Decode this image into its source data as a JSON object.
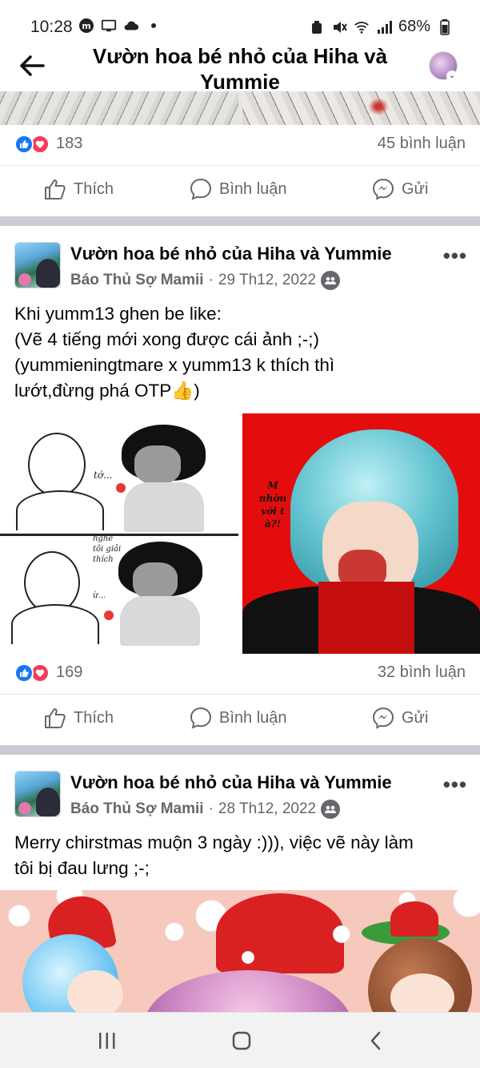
{
  "status_bar": {
    "time": "10:28",
    "battery": "68%"
  },
  "header": {
    "title": "Vườn hoa bé nhỏ của Hiha và Yummie"
  },
  "top_post": {
    "reaction_count": "183",
    "comment_count": "45 bình luận"
  },
  "actions": {
    "like": "Thích",
    "comment": "Bình luận",
    "send": "Gửi"
  },
  "posts": [
    {
      "group": "Vườn hoa bé nhỏ của Hiha và Yummie",
      "author": "Báo Thủ Sợ Mamii",
      "date": "29 Th12, 2022",
      "text_lines": [
        "Khi yumm13 ghen be like:",
        "(Vẽ 4 tiếng mới xong được cái ảnh ;-;)",
        "(yummieningtmare x yumm13 k thích thì",
        "lướt,đừng phá OTP👍)"
      ],
      "image_text": {
        "sketch_1": "tớ...",
        "sketch_2": "nghe tôi giải thích",
        "sketch_3": "ừ...",
        "red_panel": "M nhờn với t à?!"
      },
      "reaction_count": "169",
      "comment_count": "32 bình luận"
    },
    {
      "group": "Vườn hoa bé nhỏ của Hiha và Yummie",
      "author": "Báo Thủ Sợ Mamii",
      "date": "28 Th12, 2022",
      "text_lines": [
        "Merry chirstmas muộn 3 ngày :))), việc vẽ này làm",
        "tôi bị đau lưng ;-;"
      ]
    }
  ],
  "colors": {
    "like_blue": "#1877f2",
    "love_red": "#f33e58",
    "secondary_text": "#65676b",
    "divider": "#c9ccd1"
  }
}
